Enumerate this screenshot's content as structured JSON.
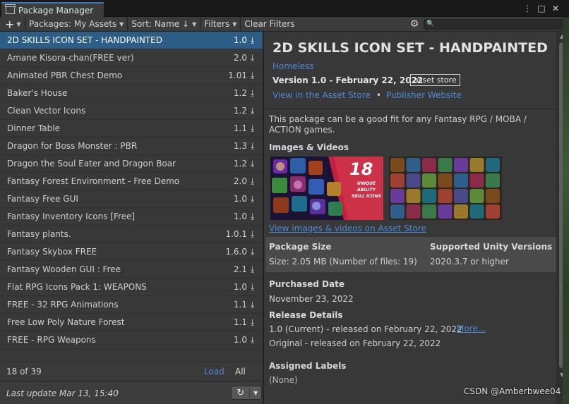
{
  "window": {
    "title": "Package Manager",
    "controls": [
      "⋮",
      "□",
      "✕"
    ]
  },
  "toolbar": {
    "add": "+",
    "packages": "Packages: My Assets",
    "sort": "Sort: Name ↓",
    "filters": "Filters",
    "clear_filters": "Clear Filters",
    "search_placeholder": ""
  },
  "packages": [
    {
      "name": "2D SKILLS ICON SET - HANDPAINTED",
      "version": "1.0",
      "selected": true
    },
    {
      "name": "Amane Kisora-chan(FREE ver)",
      "version": "2.0"
    },
    {
      "name": "Animated PBR Chest Demo",
      "version": "1.01"
    },
    {
      "name": "Baker's House",
      "version": "1.2"
    },
    {
      "name": "Clean Vector Icons",
      "version": "1.2"
    },
    {
      "name": "Dinner Table",
      "version": "1.1"
    },
    {
      "name": "Dragon for Boss Monster : PBR",
      "version": "1.3"
    },
    {
      "name": "Dragon the Soul Eater and Dragon Boar",
      "version": "1.2"
    },
    {
      "name": "Fantasy Forest Environment - Free Demo",
      "version": "2.0"
    },
    {
      "name": "Fantasy Free GUI",
      "version": "1.0"
    },
    {
      "name": "Fantasy Inventory Icons [Free]",
      "version": "1.0"
    },
    {
      "name": "Fantasy plants.",
      "version": "1.0.1"
    },
    {
      "name": "Fantasy Skybox FREE",
      "version": "1.6.0"
    },
    {
      "name": "Fantasy Wooden GUI : Free",
      "version": "2.1"
    },
    {
      "name": "Flat RPG Icons Pack 1: WEAPONS",
      "version": "1.0"
    },
    {
      "name": "FREE - 32 RPG Animations",
      "version": "1.1"
    },
    {
      "name": "Free Low Poly Nature Forest",
      "version": "1.1"
    },
    {
      "name": "FREE - RPG Weapons",
      "version": "1.0"
    }
  ],
  "list_footer": {
    "count": "18 of 39",
    "load": "Load",
    "all": "All"
  },
  "status": {
    "last_update": "Last update Mar 13, 15:40",
    "refresh_icon": "↻",
    "caret": "▼"
  },
  "detail": {
    "title": "2D SKILLS ICON SET - HANDPAINTED",
    "author": "Homeless",
    "version": "Version 1.0 - February 22, 2022",
    "tag": "asset store",
    "link_asset_store": "View in the Asset Store",
    "link_dot": "•",
    "link_publisher": "Publisher Website",
    "description": "This package can be a good fit for any Fantasy RPG / MOBA / ACTION games.",
    "media_heading": "Images & Videos",
    "thumb1_number": "18",
    "thumb1_caption": "UNIQUE ABILITY SKILL ICONS",
    "media_link": "View images & videos on Asset Store",
    "size_heading": "Package Size",
    "size_value": "Size: 2.05 MB (Number of files: 19)",
    "unity_heading": "Supported Unity Versions",
    "unity_value": "2020.3.7 or higher",
    "purchased_heading": "Purchased Date",
    "purchased_value": "November 23, 2022",
    "release_heading": "Release Details",
    "release_current": "1.0 (Current) - released on February 22, 2022",
    "release_more": "More...",
    "release_original": "Original - released on February 22, 2022",
    "labels_heading": "Assigned Labels",
    "labels_value": "(None)"
  },
  "watermark": "CSDN @Amberbwee04",
  "icons": {
    "gear": "gear-icon",
    "search": "search-icon",
    "download": "download-icon",
    "refresh": "refresh-icon"
  },
  "colors": {
    "selected_row": "#2c5d87",
    "link": "#4c8ad8",
    "tab_accent": "#3a79bb"
  }
}
